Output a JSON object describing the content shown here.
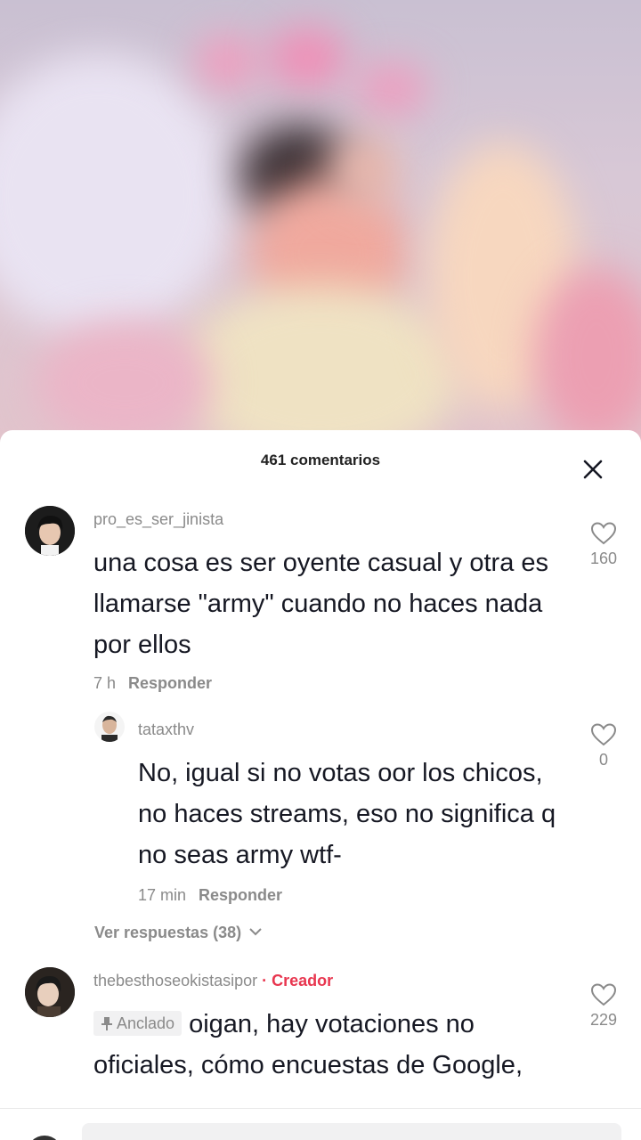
{
  "sheet": {
    "count_label": "461 comentarios"
  },
  "comments": [
    {
      "username": "pro_es_ser_jinista",
      "text": "una cosa es ser oyente casual y otra es llamarse \"army\" cuando no haces nada por ellos",
      "time": "7 h",
      "reply_label": "Responder",
      "likes": "160",
      "replies": [
        {
          "username": "tataxthv",
          "text": "No, igual si no votas oor los chicos, no haces streams, eso no significa q no seas army wtf-",
          "time": "17 min",
          "reply_label": "Responder",
          "likes": "0"
        }
      ],
      "view_replies_label": "Ver respuestas (38)"
    },
    {
      "username": "thebesthoseokistasipor",
      "badge": "· Creador",
      "pinned_label": "Anclado",
      "text": "oigan, hay votaciones no oficiales, cómo encuestas de Google, primero voten en los SMA",
      "likes": "229"
    }
  ],
  "icons": {
    "close": "close-icon",
    "heart": "heart-icon",
    "pin": "pin-icon",
    "chevron": "chevron-down-icon"
  },
  "colors": {
    "creator": "#e8364f",
    "muted": "#8a8a8a",
    "text": "#161823"
  }
}
